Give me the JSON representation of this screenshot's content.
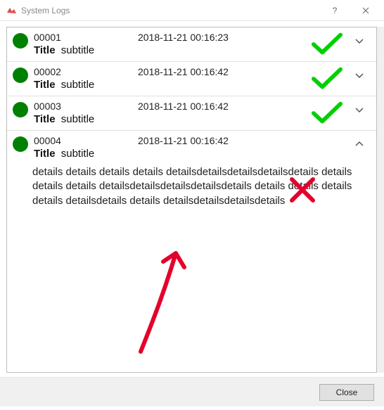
{
  "window": {
    "title": "System Logs",
    "help_label": "?",
    "close_label": "✕"
  },
  "logs": [
    {
      "id": "00001",
      "title": "Title",
      "subtitle": "subtitle",
      "timestamp": "2018-11-21 00:16:23",
      "status": "ok",
      "expanded": false
    },
    {
      "id": "00002",
      "title": "Title",
      "subtitle": "subtitle",
      "timestamp": "2018-11-21 00:16:42",
      "status": "ok",
      "expanded": false
    },
    {
      "id": "00003",
      "title": "Title",
      "subtitle": "subtitle",
      "timestamp": "2018-11-21 00:16:42",
      "status": "ok",
      "expanded": false
    },
    {
      "id": "00004",
      "title": "Title",
      "subtitle": "subtitle",
      "timestamp": "2018-11-21 00:16:42",
      "status": "none",
      "expanded": true,
      "details": "details details details details detailsdetailsdetailsdetailsdetails details details details detailsdetailsdetailsdetailsdetails details details details details detailsdetails details detailsdetailsdetailsdetails"
    }
  ],
  "footer": {
    "close_label": "Close"
  },
  "colors": {
    "status_ok": "#008000",
    "check_stroke": "#00D000",
    "annotation": "#E4002B"
  }
}
